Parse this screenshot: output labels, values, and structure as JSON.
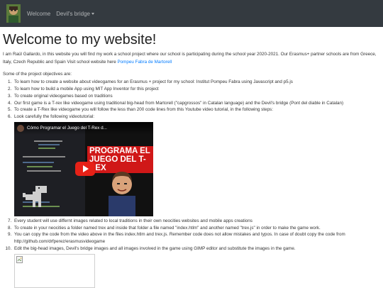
{
  "navbar": {
    "brand_icon": "avatar-logo",
    "links": [
      {
        "label": "Welcome"
      },
      {
        "label": "Devil's bridge"
      }
    ]
  },
  "page": {
    "title": "Welcome to my website!",
    "intro": "I am Raül Gallardo, in this website you will find my work a school project where our school is participating during the school year 2020-2021. Our Erasmus+ partner schools are from Greece, Italy, Czech Republic and Spain Visit school website here ",
    "intro_link": "Pompeu Fabra de Martorell",
    "objectives_heading": "Some of the project objectives are:",
    "objectives": [
      "To learn how to create a website about videogames for an Erasmus + project for my school: Institut Pompeu Fabra using Javascript and p5.js",
      "To learn how to build a mobile App using MIT App Inventor for this project",
      "To create original videogames based on traditions",
      "Our first game is a T-rex like videogame using traditional big-head from Martorell (\"capgrossos\" in Catalan language) and the Devil's bridge (Pont del diable in Catalan)",
      "To create a T-Rex like videogame you will follow the less than 200 code lines from this Youtube video tutorial, in the following steps:",
      "Look carefully the following videotutorial:",
      "Every student will use differnt images related to local traditions in their own neocities websites and mobile apps creations",
      "To create in your neocities a folder named trex and inside that folder a file named \"index.htlm\" and another named \"trex.js\" in order to make the game work.",
      "You can copy the code from the video above in the files index.htlm and trex.js. Remember code does not allow mistakes and typos. In case of doubt copy the code from http://github.com/drfperez/erasmusvideogame",
      "Edit the big-head images, Devil's bridge images and all images involved in the game using GIMP editor and substitute the images in the game."
    ],
    "video": {
      "title": "Cómo Programar el Juego del T-Rex d...",
      "thumbnail_text_1": "PROGRAMA EL",
      "thumbnail_text_2": "JUEGO DEL T-REX"
    }
  }
}
